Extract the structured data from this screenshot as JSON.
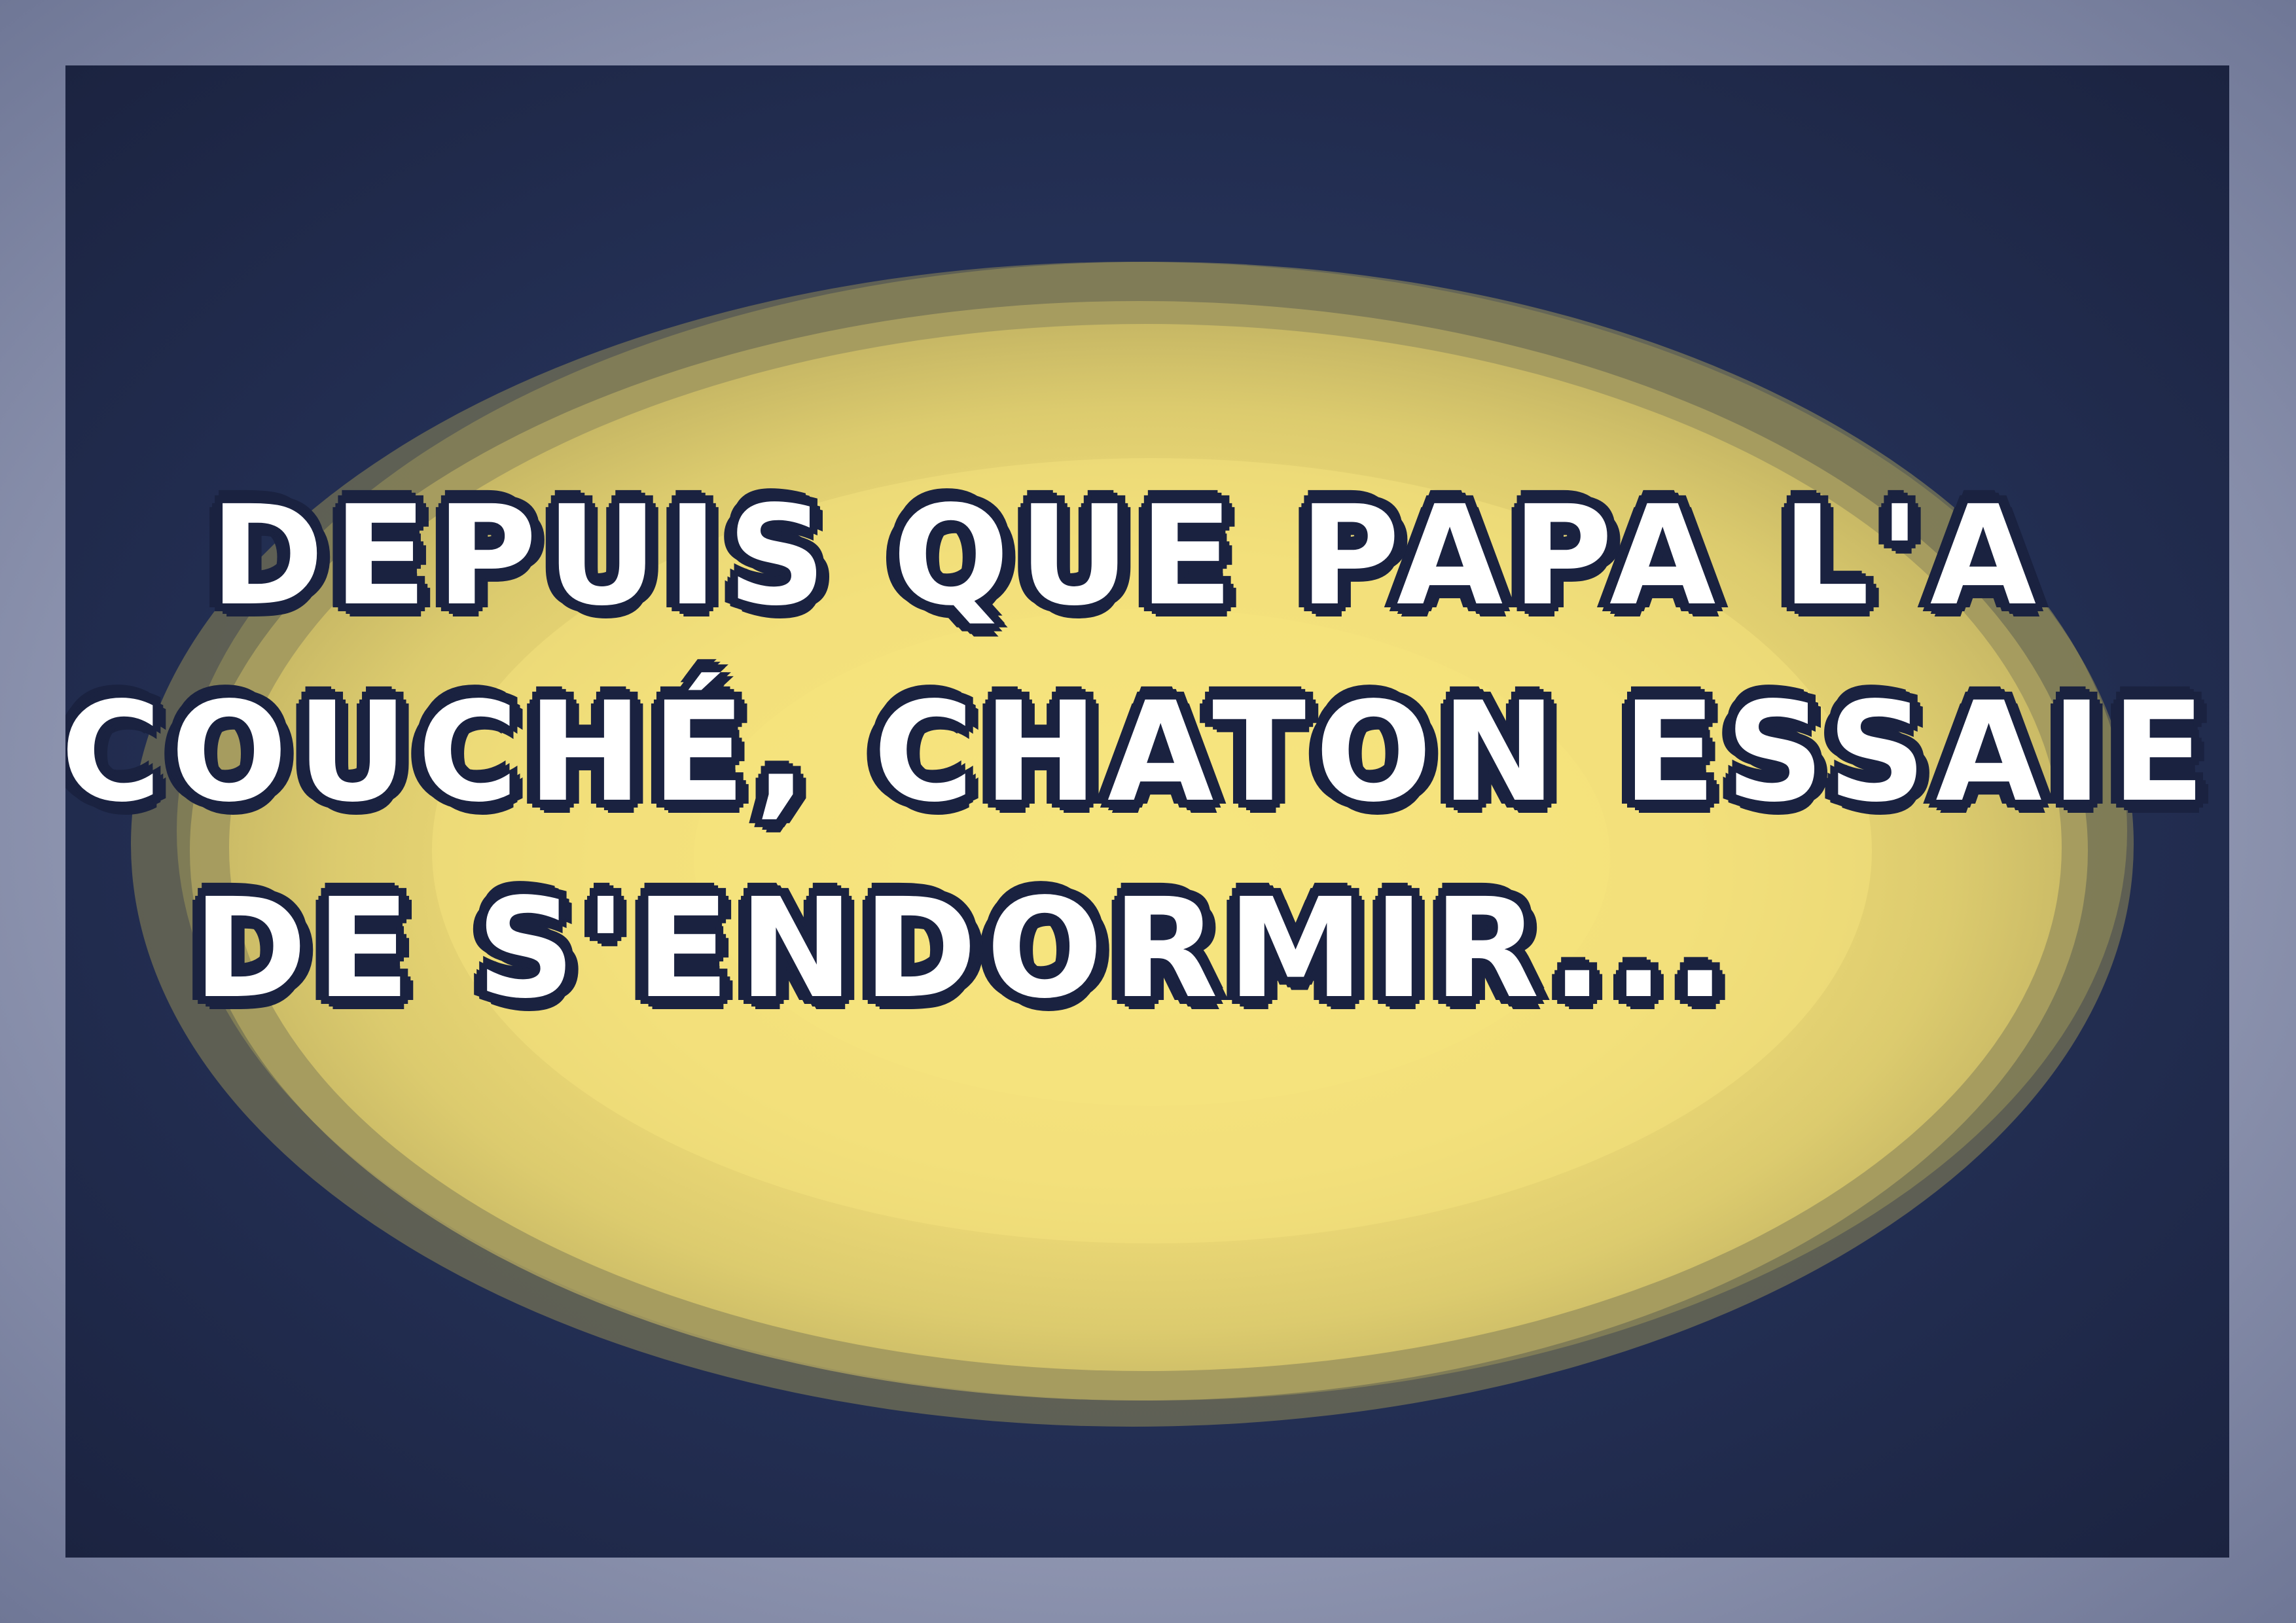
{
  "caption": {
    "line1": "DEPUIS QUE PAPA L'A",
    "line2": "COUCHÉ, CHATON ESSAIE",
    "line3": "DE S'ENDORMIR..."
  },
  "colors": {
    "frame": "#9ea4bd",
    "panel_background": "#252f4d",
    "glow_center": "#f5e37c",
    "glow_edge": "#7a7a52",
    "text_fill": "#ffffff",
    "text_outline": "#1a2240"
  }
}
